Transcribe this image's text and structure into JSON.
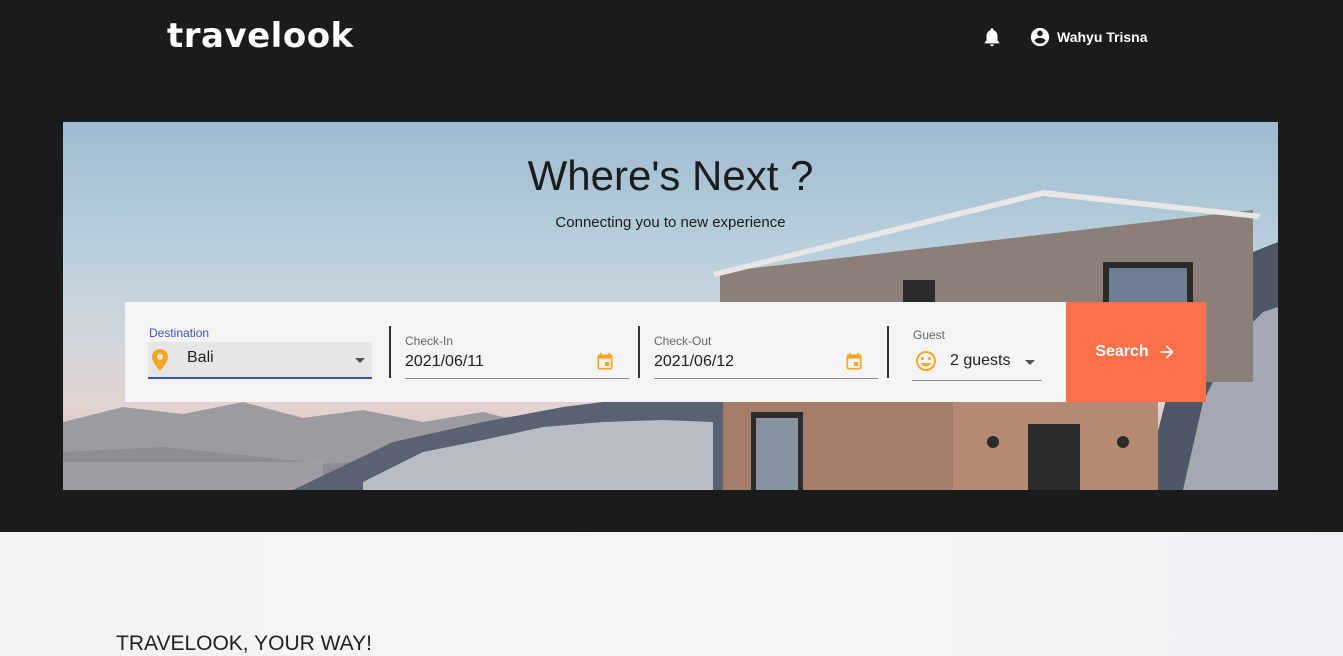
{
  "header": {
    "logo": "travelook",
    "user_name": "Wahyu Trisna",
    "icons": {
      "notification": "bell-icon",
      "account": "account-circle-icon"
    }
  },
  "hero": {
    "title": "Where's Next ?",
    "subtitle": "Connecting you to new experience"
  },
  "search": {
    "destination": {
      "label": "Destination",
      "value": "Bali",
      "icon": "location-pin-icon"
    },
    "check_in": {
      "label": "Check-In",
      "value": "2021/06/11",
      "icon": "calendar-icon"
    },
    "check_out": {
      "label": "Check-Out",
      "value": "2021/06/12",
      "icon": "calendar-icon"
    },
    "guest": {
      "label": "Guest",
      "value": "2 guests",
      "icon": "smiley-icon"
    },
    "button_label": "Search"
  },
  "section": {
    "tagline": "TRAVELOOK, YOUR WAY!"
  },
  "colors": {
    "header_bg": "#1c1b1b",
    "accent": "#fd704b",
    "icon_orange": "#f5a623",
    "focus_blue": "#3f51b5"
  }
}
